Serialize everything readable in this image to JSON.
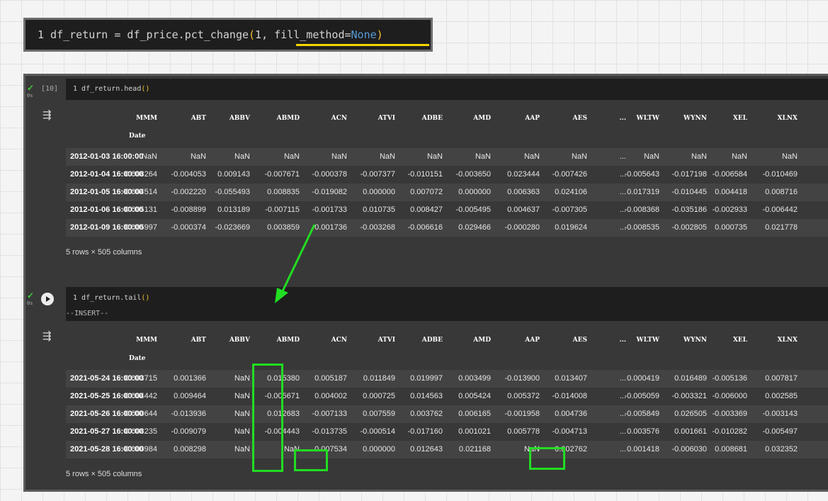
{
  "snippet": {
    "line_no": "1",
    "pre": " df_return = df_price.pct_change",
    "open_paren": "(",
    "args": "1, fill_method=",
    "none_kw": "None",
    "close_paren": ")"
  },
  "cell1": {
    "exec_count": "[10]",
    "time": "0s",
    "line_no": "1",
    "code": " df_return.head",
    "parens": "()",
    "output_icon": "⇶",
    "table": {
      "index_name": "Date",
      "columns": [
        "MMM",
        "ABT",
        "ABBV",
        "ABMD",
        "ACN",
        "ATVI",
        "ADBE",
        "AMD",
        "AAP",
        "AES",
        "...",
        "WLTW",
        "WYNN",
        "XEL",
        "XLNX"
      ],
      "rows": [
        {
          "date": "2012-01-03 16:00:00",
          "values": [
            "NaN",
            "NaN",
            "NaN",
            "NaN",
            "NaN",
            "NaN",
            "NaN",
            "NaN",
            "NaN",
            "NaN",
            "...",
            "NaN",
            "NaN",
            "NaN",
            "NaN"
          ]
        },
        {
          "date": "2012-01-04 16:00:00",
          "values": [
            "0.008264",
            "-0.004053",
            "0.009143",
            "-0.007671",
            "-0.000378",
            "-0.007377",
            "-0.010151",
            "-0.003650",
            "0.023444",
            "-0.007426",
            "...",
            "-0.005643",
            "-0.017198",
            "-0.006584",
            "-0.010469"
          ]
        },
        {
          "date": "2012-01-05 16:00:00",
          "values": [
            "-0.004514",
            "-0.002220",
            "-0.055493",
            "0.008835",
            "-0.019082",
            "0.000000",
            "0.007072",
            "0.000000",
            "0.006363",
            "0.024106",
            "...",
            "0.017319",
            "-0.010445",
            "0.004418",
            "0.008716"
          ]
        },
        {
          "date": "2012-01-06 16:00:00",
          "values": [
            "-0.005131",
            "-0.008899",
            "0.013189",
            "-0.007115",
            "-0.001733",
            "0.010735",
            "0.008427",
            "-0.005495",
            "0.004637",
            "-0.007305",
            "...",
            "-0.008368",
            "-0.035186",
            "-0.002933",
            "-0.006442"
          ]
        },
        {
          "date": "2012-01-09 16:00:00",
          "values": [
            "0.005997",
            "-0.000374",
            "-0.023669",
            "0.003859",
            "-0.001736",
            "-0.003268",
            "-0.006616",
            "0.029466",
            "-0.000280",
            "0.019624",
            "...",
            "-0.008535",
            "-0.002805",
            "0.000735",
            "0.021778"
          ]
        }
      ],
      "footer": "5 rows × 505 columns"
    }
  },
  "cell2": {
    "time": "0s",
    "line_no": "1",
    "code": " df_return.tail",
    "parens": "()",
    "mode": "--INSERT--",
    "output_icon": "⇶",
    "table": {
      "index_name": "Date",
      "columns": [
        "MMM",
        "ABT",
        "ABBV",
        "ABMD",
        "ACN",
        "ATVI",
        "ADBE",
        "AMD",
        "AAP",
        "AES",
        "...",
        "WLTW",
        "WYNN",
        "XEL",
        "XLNX"
      ],
      "rows": [
        {
          "date": "2021-05-24 16:00:00",
          "values": [
            "0.003715",
            "0.001366",
            "NaN",
            "0.015380",
            "0.005187",
            "0.011849",
            "0.019997",
            "0.003499",
            "-0.013900",
            "0.013407",
            "...",
            "0.000419",
            "0.016489",
            "-0.005136",
            "0.007817"
          ]
        },
        {
          "date": "2021-05-25 16:00:00",
          "values": [
            "-0.004442",
            "0.009464",
            "NaN",
            "-0.005671",
            "0.004002",
            "0.000725",
            "0.014563",
            "0.005424",
            "0.005372",
            "-0.014008",
            "...",
            "-0.005059",
            "-0.003321",
            "-0.006000",
            "0.002585"
          ]
        },
        {
          "date": "2021-05-26 16:00:00",
          "values": [
            "-0.000644",
            "-0.013936",
            "NaN",
            "0.012683",
            "-0.007133",
            "0.007559",
            "0.003762",
            "0.006165",
            "-0.001958",
            "0.004736",
            "...",
            "-0.005849",
            "0.026505",
            "-0.003369",
            "-0.003143"
          ]
        },
        {
          "date": "2021-05-27 16:00:00",
          "values": [
            "0.008235",
            "-0.009079",
            "NaN",
            "-0.004443",
            "-0.013735",
            "-0.000514",
            "-0.017160",
            "0.001021",
            "0.005778",
            "-0.004713",
            "...",
            "0.003576",
            "0.001661",
            "-0.010282",
            "-0.005497"
          ]
        },
        {
          "date": "2021-05-28 16:00:00",
          "values": [
            "-0.000984",
            "0.008298",
            "NaN",
            "NaN",
            "0.007534",
            "0.000000",
            "0.012643",
            "0.021168",
            "NaN",
            "0.002762",
            "...",
            "0.001418",
            "-0.006030",
            "0.008681",
            "0.032352"
          ]
        }
      ],
      "footer": "5 rows × 505 columns"
    }
  },
  "colors": {
    "highlight_box": "#22dd22",
    "underline": "#f5d400",
    "panel_bg": "#383838",
    "code_bg": "#1e1e1e"
  }
}
